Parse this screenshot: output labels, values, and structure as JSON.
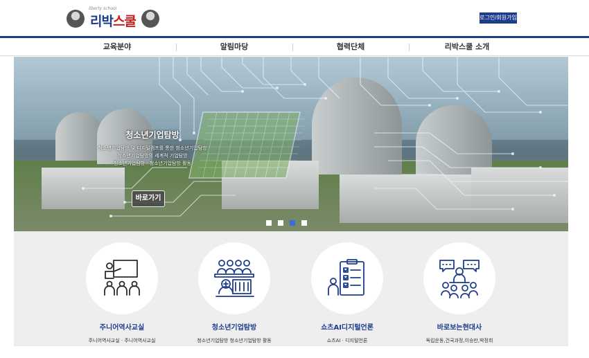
{
  "header": {
    "logo_text_a": "리박",
    "logo_text_b": "스쿨",
    "logo_tagline": "liberty school",
    "login_label": "로그인/회원가입"
  },
  "nav": {
    "items": [
      {
        "label": "교육분야"
      },
      {
        "label": "알림마당"
      },
      {
        "label": "협력단체"
      },
      {
        "label": "리박스쿨 소개"
      }
    ]
  },
  "hero": {
    "title": "청소년기업탐방",
    "desc_lines": [
      "청소년기업탐방 및 디지털캠프를 통한 청소년기업탐방",
      "청소년기업탐방의 세계적 기업탐방",
      "청소년기업탐방 · 청소년기업탐방 활동"
    ],
    "button_label": "바로가기",
    "slides": 4,
    "active_slide": 3
  },
  "cards": [
    {
      "title": "주니어역사교실",
      "sub": "주니어역사교실 · 주니어역사교실",
      "icon": "teacher-classroom-icon"
    },
    {
      "title": "청소년기업탐방",
      "sub": "청소년기업탐방 청소년기업탐방 활동",
      "icon": "group-meeting-icon"
    },
    {
      "title": "쇼츠AI디지털언론",
      "sub": "쇼츠AI · 디지털언론",
      "icon": "checklist-icon"
    },
    {
      "title": "바로보는현대사",
      "sub": "독립운동,건국과정,이승만,박정희",
      "icon": "discussion-icon"
    }
  ],
  "colors": {
    "brand_blue": "#1c3c8c",
    "brand_red": "#c81e1e",
    "active_dot": "#3b6fd3"
  }
}
